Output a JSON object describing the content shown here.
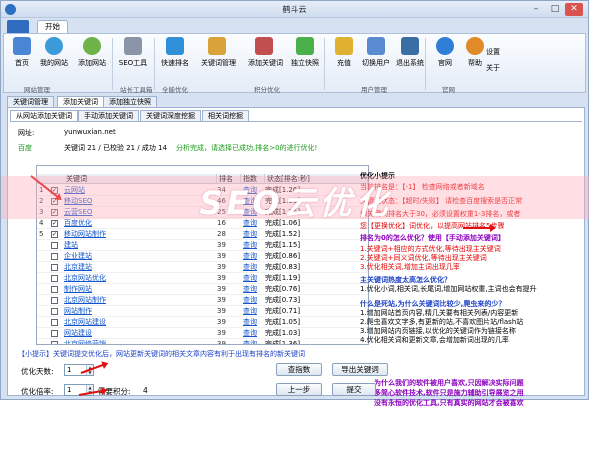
{
  "window": {
    "title": "鹤斗云"
  },
  "ribbon": {
    "tab_start": "开始"
  },
  "toolbar": {
    "buttons": [
      {
        "label": "首页"
      },
      {
        "label": "我的网站"
      },
      {
        "label": "添加网站"
      },
      {
        "label": "SEO工具"
      },
      {
        "label": "快速排名"
      },
      {
        "label": "关键词管理"
      },
      {
        "label": "添加关键词"
      },
      {
        "label": "独立快照"
      },
      {
        "label": "充值"
      },
      {
        "label": "切换用户"
      },
      {
        "label": "退出系统"
      },
      {
        "label": "官网"
      },
      {
        "label": "帮助"
      },
      {
        "label": "设置"
      },
      {
        "label": "关于"
      }
    ],
    "groups": [
      "网站管理",
      "站长工具箱",
      "全能优化",
      "积分优化",
      "用户管理",
      "官网"
    ]
  },
  "config_tabs": [
    "关键词管理",
    "添加关键词",
    "添加独立快照"
  ],
  "sub_tabs": [
    "从网站添加关键词",
    "手动添加关键词",
    "关键词深度挖掘",
    "相关词挖掘"
  ],
  "site": {
    "label": "网址:",
    "url": "yunwuxian.net"
  },
  "engine": "百度",
  "status": {
    "keywords": "关键词 21 / 已校验 21 / 成功 14",
    "message": "分析完成，请选择已成功,排名>0的进行优化!"
  },
  "table": {
    "headers": [
      "关键词",
      "排名",
      "指数",
      "状态[排名:秒]"
    ],
    "rows": [
      {
        "num": "1",
        "checked": true,
        "kw": "云网站",
        "rank": "34",
        "idx": "查询",
        "st": "完成[1.26]"
      },
      {
        "num": "2",
        "checked": true,
        "kw": "移动SEO",
        "rank": "46",
        "idx": "查询",
        "st": "完成[1.09]"
      },
      {
        "num": "3",
        "checked": true,
        "kw": "云营SEO",
        "rank": "25",
        "idx": "查询",
        "st": "完成[1.25]"
      },
      {
        "num": "4",
        "checked": true,
        "kw": "百度优化",
        "rank": "16",
        "idx": "查询",
        "st": "完成[1.06]"
      },
      {
        "num": "5",
        "checked": true,
        "kw": "移动网站制作",
        "rank": "28",
        "idx": "查询",
        "st": "完成[1.52]"
      },
      {
        "num": "",
        "checked": false,
        "kw": "建站",
        "rank": "39",
        "idx": "查询",
        "st": "完成[1.15]"
      },
      {
        "num": "",
        "checked": false,
        "kw": "企业建站",
        "rank": "39",
        "idx": "查询",
        "st": "完成[0.86]"
      },
      {
        "num": "",
        "checked": false,
        "kw": "北京建站",
        "rank": "39",
        "idx": "查询",
        "st": "完成[0.83]"
      },
      {
        "num": "",
        "checked": false,
        "kw": "北京网站优化",
        "rank": "39",
        "idx": "查询",
        "st": "完成[1.19]"
      },
      {
        "num": "",
        "checked": false,
        "kw": "制作网站",
        "rank": "39",
        "idx": "查询",
        "st": "完成[0.76]"
      },
      {
        "num": "",
        "checked": false,
        "kw": "北京网站制作",
        "rank": "39",
        "idx": "查询",
        "st": "完成[0.73]"
      },
      {
        "num": "",
        "checked": false,
        "kw": "网站制作",
        "rank": "39",
        "idx": "查询",
        "st": "完成[0.71]"
      },
      {
        "num": "",
        "checked": false,
        "kw": "北京网站建设",
        "rank": "39",
        "idx": "查询",
        "st": "完成[1.05]"
      },
      {
        "num": "",
        "checked": false,
        "kw": "网站建设",
        "rank": "39",
        "idx": "查询",
        "st": "完成[1.03]"
      },
      {
        "num": "",
        "checked": false,
        "kw": "北京网络营销",
        "rank": "39",
        "idx": "查询",
        "st": "完成[1.36]"
      },
      {
        "num": "",
        "checked": false,
        "kw": "网络营销",
        "rank": "39",
        "idx": "查询",
        "st": "完成[0.92]"
      }
    ]
  },
  "hints": {
    "title": "优化小提示",
    "l1": "当前排名是：【-1】 检查网络或者新域名",
    "l2": "关键词状态：【超时/失败】 请检查百度搜索是否正常",
    "l3": "如关键词排名大于30，必须设置权重1-3排名，或者",
    "l4": "您【更换优化】词优化，以提高网站排名5步骤",
    "l5": "排名为0的怎么优化？使用【手动添加关键词】",
    "l6": "1.关键词+相应的方式优化,等待出现主关键词",
    "l7": "2.关键词+同义词优化,等待出现主关键词",
    "l8": "3.优化相关词,增加主词出现几率",
    "q2": "主关键词热度太高怎么优化？",
    "m1": "1.优化小词,相关词,长尾词,增加网站权重,主词也会有提升",
    "q3": "什么是死站,为什么关键词比较少,爬虫来的少？",
    "d1": "1.增加网站首页内容,精几关要有相关列表/内容更新",
    "d2": "2.爬虫喜欢文字多,有更新的站,不喜欢图片站/flash站",
    "d3": "3.增加网站内页链接,以优化的关键词作为链接名称",
    "d4": "4.优化相关词和更新文章,会增加新词出现的几率",
    "p1": "为什么我们的软件被用户喜欢,只因解决实际问题",
    "p2": "多简心软件技术,软件只是施力辅助引导展览之用",
    "p3": "没有永恒的优化工具,只有真实的网站才会被喜欢"
  },
  "note": "【小提示】关键词提交优化后，网站更新关键词的相关文章内容有利于出现有排名的新关键词",
  "form": {
    "days_label": "优化天数:",
    "days_value": "1",
    "rate_label": "优化倍率:",
    "rate_value": "1",
    "points_label": "需要积分:",
    "points_value": "4",
    "btn_query": "查指数",
    "btn_export": "导出关键词",
    "btn_prev": "上一步",
    "btn_submit": "提交"
  },
  "watermark": "SEO云优化",
  "colors": {
    "accent": "#2f6cbf",
    "watermark": "#ffaab9"
  }
}
